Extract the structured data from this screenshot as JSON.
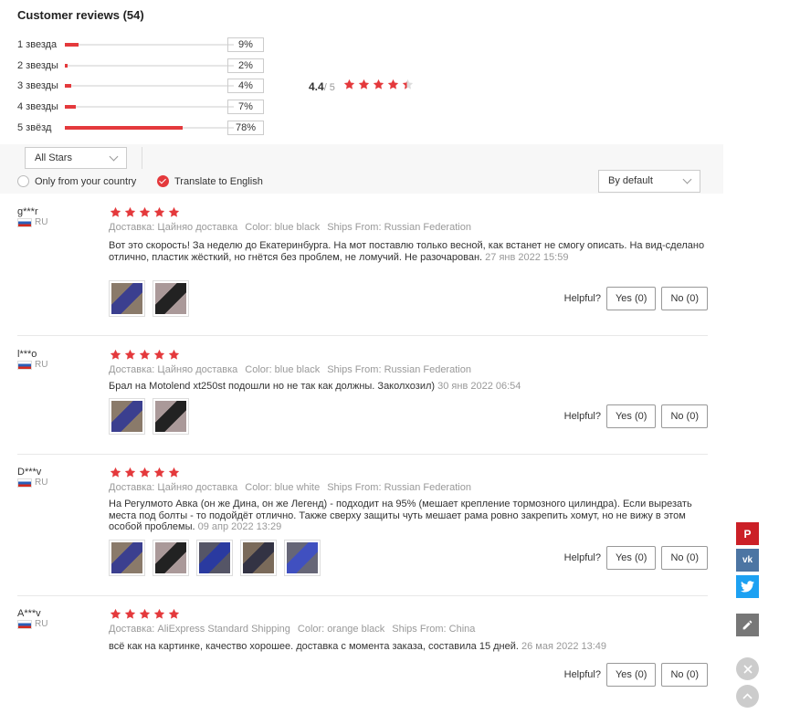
{
  "header": {
    "title": "Customer reviews (54)"
  },
  "distribution": [
    {
      "label": "1 звезда",
      "pct": "9%",
      "value": 9
    },
    {
      "label": "2 звезды",
      "pct": "2%",
      "value": 2
    },
    {
      "label": "3 звезды",
      "pct": "4%",
      "value": 4
    },
    {
      "label": "4 звезды",
      "pct": "7%",
      "value": 7
    },
    {
      "label": "5 звёзд",
      "pct": "78%",
      "value": 78
    }
  ],
  "average": {
    "score": "4.4",
    "out_of": "/ 5",
    "stars": 4.4
  },
  "filters": {
    "stars_select": "All Stars",
    "only_country": "Only from your country",
    "translate": "Translate to English",
    "sort_select": "By default"
  },
  "helpful_label": "Helpful?",
  "reviews": [
    {
      "user": "g***r",
      "country": "RU",
      "stars": 5,
      "delivery": "Доставка: Цайняо доставка",
      "color": "Color: blue black",
      "ships": "Ships From: Russian Federation",
      "text": "Вот это скорость! За неделю до Екатеринбурга. На мот поставлю только весной, как встанет не смогу описать. На вид-сделано отлично, пластик жёсткий, но гнётся без проблем, не ломучий. Не разочарован.",
      "date": "27 янв 2022 15:59",
      "yes": "Yes (0)",
      "no": "No (0)",
      "thumbs": [
        "photo-1",
        "photo-2"
      ]
    },
    {
      "user": "l***o",
      "country": "RU",
      "stars": 5,
      "delivery": "Доставка: Цайняо доставка",
      "color": "Color: blue black",
      "ships": "Ships From: Russian Federation",
      "text": "Брал на Motolend xt250st подошли но не так как должны. Заколхозил)",
      "date": "30 янв 2022 06:54",
      "yes": "Yes (0)",
      "no": "No (0)",
      "thumbs": [
        "photo-1",
        "photo-2"
      ]
    },
    {
      "user": "D***v",
      "country": "RU",
      "stars": 5,
      "delivery": "Доставка: Цайняо доставка",
      "color": "Color: blue white",
      "ships": "Ships From: Russian Federation",
      "text": "На Регулмото Авка (он же Дина, он же Легенд) - подходит на 95% (мешает крепление тормозного цилиндра). Если вырезать места под болты - то подойдёт отлично. Также сверху защиты чуть мешает рама ровно закрепить хомут, но не вижу в этом особой проблемы.",
      "date": "09 апр 2022 13:29",
      "yes": "Yes (0)",
      "no": "No (0)",
      "thumbs": [
        "photo-1",
        "photo-2",
        "photo-3",
        "photo-4",
        "photo-5"
      ]
    },
    {
      "user": "A***v",
      "country": "RU",
      "stars": 5,
      "delivery": "Доставка: AliExpress Standard Shipping",
      "color": "Color: orange black",
      "ships": "Ships From: China",
      "text": "всё как на картинке, качество хорошее. доставка с момента заказа, составила 15 дней.",
      "date": "26 мая 2022 13:49",
      "yes": "Yes (0)",
      "no": "No (0)",
      "thumbs": []
    }
  ],
  "social": {
    "pinterest": "P",
    "vk": "vk",
    "twitter": "t"
  },
  "colors": {
    "accent": "#e4393c",
    "pinterest": "#cb2027",
    "vk": "#4c75a3",
    "twitter": "#1da1f2",
    "edit": "#777777"
  }
}
